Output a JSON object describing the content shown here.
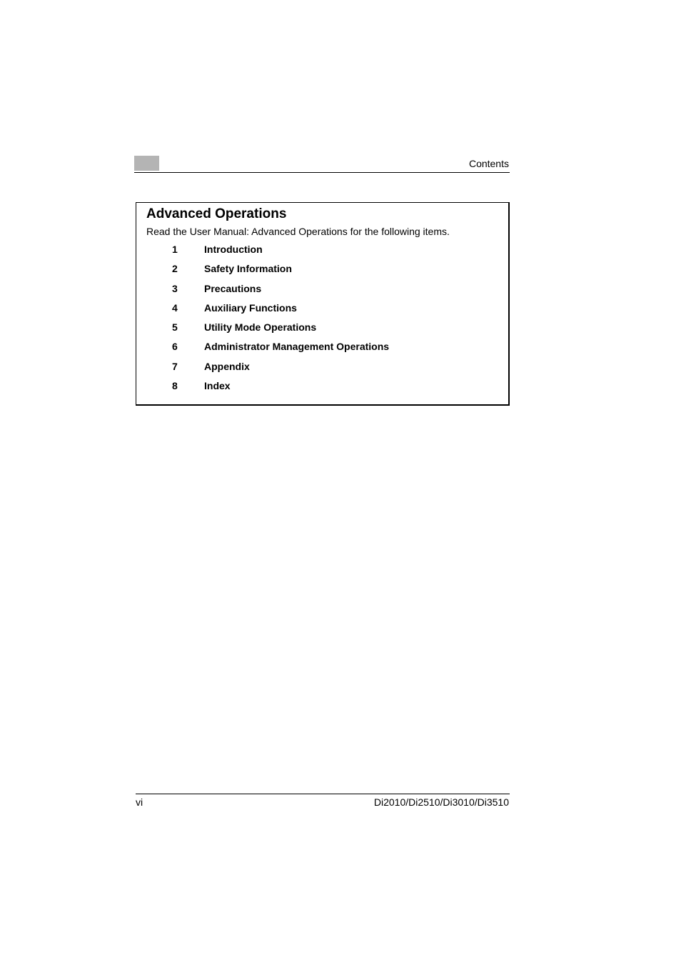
{
  "header": {
    "section_title": "Contents"
  },
  "box": {
    "title": "Advanced Operations",
    "intro": "Read the User Manual: Advanced Operations for the following items.",
    "items": [
      {
        "num": "1",
        "label": "Introduction"
      },
      {
        "num": "2",
        "label": "Safety Information"
      },
      {
        "num": "3",
        "label": "Precautions"
      },
      {
        "num": "4",
        "label": "Auxiliary Functions"
      },
      {
        "num": "5",
        "label": "Utility Mode Operations"
      },
      {
        "num": "6",
        "label": "Administrator Management Operations"
      },
      {
        "num": "7",
        "label": "Appendix"
      },
      {
        "num": "8",
        "label": "Index"
      }
    ]
  },
  "footer": {
    "page_number": "vi",
    "model": "Di2010/Di2510/Di3010/Di3510"
  }
}
